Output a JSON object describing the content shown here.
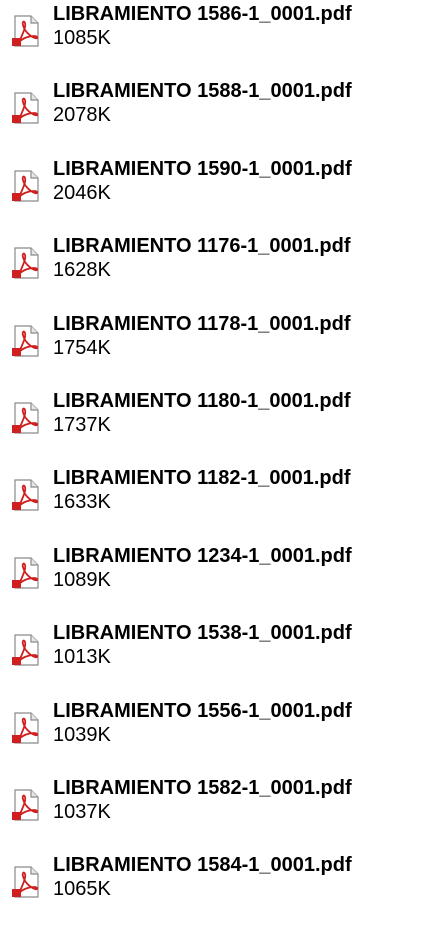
{
  "files": [
    {
      "name": "LIBRAMIENTO 1586-1_0001.pdf",
      "size": "1085K",
      "icon": "pdf-icon"
    },
    {
      "name": "LIBRAMIENTO 1588-1_0001.pdf",
      "size": "2078K",
      "icon": "pdf-icon"
    },
    {
      "name": "LIBRAMIENTO 1590-1_0001.pdf",
      "size": "2046K",
      "icon": "pdf-icon"
    },
    {
      "name": "LIBRAMIENTO 1176-1_0001.pdf",
      "size": "1628K",
      "icon": "pdf-icon"
    },
    {
      "name": "LIBRAMIENTO 1178-1_0001.pdf",
      "size": "1754K",
      "icon": "pdf-icon"
    },
    {
      "name": "LIBRAMIENTO 1180-1_0001.pdf",
      "size": "1737K",
      "icon": "pdf-icon"
    },
    {
      "name": "LIBRAMIENTO 1182-1_0001.pdf",
      "size": "1633K",
      "icon": "pdf-icon"
    },
    {
      "name": "LIBRAMIENTO 1234-1_0001.pdf",
      "size": "1089K",
      "icon": "pdf-icon"
    },
    {
      "name": "LIBRAMIENTO 1538-1_0001.pdf",
      "size": "1013K",
      "icon": "pdf-icon"
    },
    {
      "name": "LIBRAMIENTO 1556-1_0001.pdf",
      "size": "1039K",
      "icon": "pdf-icon"
    },
    {
      "name": "LIBRAMIENTO 1582-1_0001.pdf",
      "size": "1037K",
      "icon": "pdf-icon"
    },
    {
      "name": "LIBRAMIENTO 1584-1_0001.pdf",
      "size": "1065K",
      "icon": "pdf-icon"
    }
  ],
  "colors": {
    "icon_red": "#d01f1f",
    "text": "#000000",
    "background": "#ffffff"
  }
}
